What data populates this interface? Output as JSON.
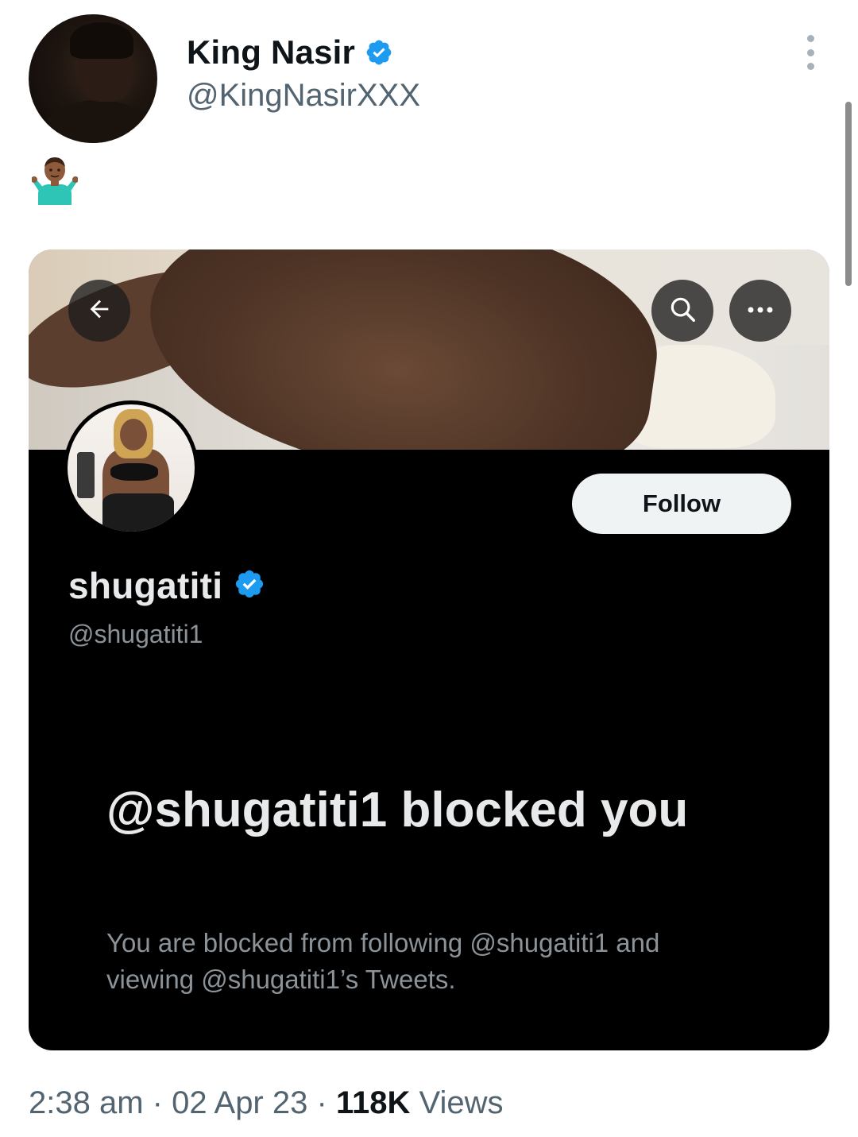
{
  "tweet": {
    "author": {
      "display_name": "King Nasir",
      "handle": "@KingNasirXXX",
      "verified": true
    },
    "text_emoji": "🤷🏾‍♂️",
    "meta": {
      "time": "2:38 am",
      "separator": "·",
      "date": "02 Apr 23",
      "views_count": "118K",
      "views_label": "Views"
    }
  },
  "embedded_profile": {
    "follow_label": "Follow",
    "name": "shugatiti",
    "handle": "@shugatiti1",
    "verified": true,
    "blocked_title": "@shugatiti1 blocked you",
    "blocked_description": "You are blocked from following @shugatiti1 and viewing @shugatiti1’s Tweets.",
    "icons": [
      "back-arrow-icon",
      "search-icon",
      "more-icon"
    ]
  },
  "colors": {
    "verified_blue": "#1d9bf0",
    "secondary_text": "#536471",
    "profile_bg": "#000000"
  }
}
